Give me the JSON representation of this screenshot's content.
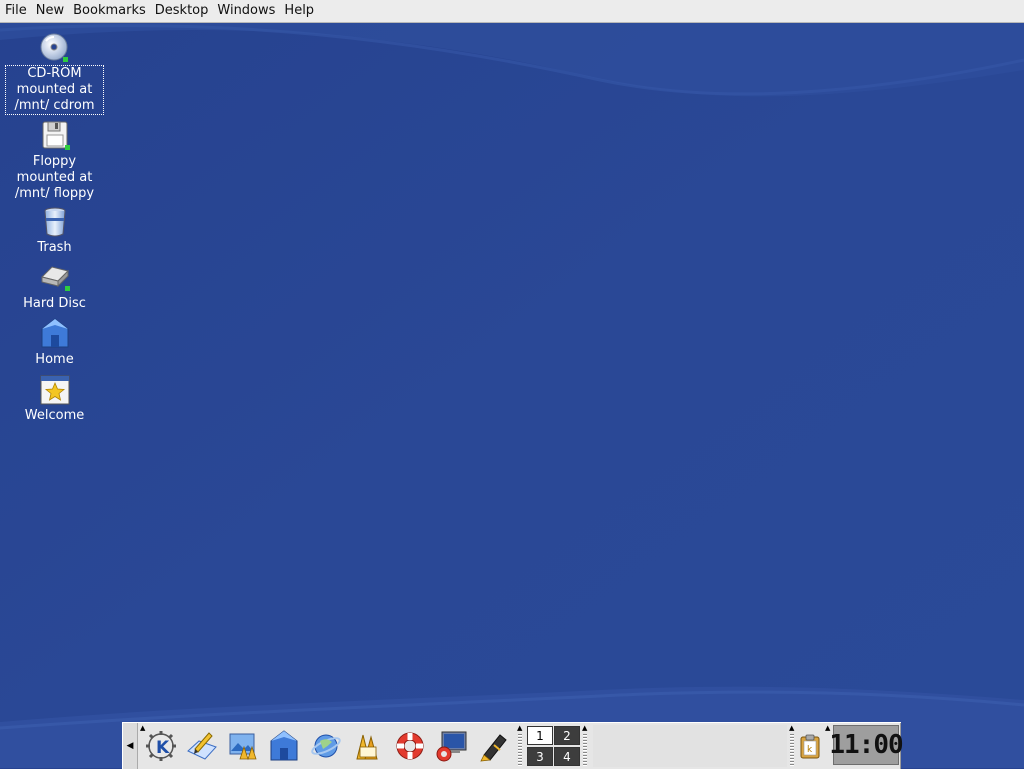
{
  "menubar": {
    "items": [
      "File",
      "New",
      "Bookmarks",
      "Desktop",
      "Windows",
      "Help"
    ]
  },
  "desktop": {
    "icons": [
      {
        "label": "CD-ROM mounted at /mnt/ cdrom",
        "icon": "cdrom-icon"
      },
      {
        "label": "Floppy mounted at /mnt/ floppy",
        "icon": "floppy-icon"
      },
      {
        "label": "Trash",
        "icon": "trash-icon"
      },
      {
        "label": "Hard Disc",
        "icon": "harddisk-icon"
      },
      {
        "label": "Home",
        "icon": "home-icon"
      },
      {
        "label": "Welcome",
        "icon": "welcome-icon"
      }
    ]
  },
  "panel": {
    "launchers": [
      "kde-menu-icon",
      "kmail-icon",
      "desktop-preview-icon",
      "home-folder-icon",
      "konqueror-icon",
      "office-icon",
      "help-lifebuoy-icon",
      "terminal-icon",
      "pen-editor-icon"
    ],
    "pager": {
      "desktops": [
        "1",
        "2",
        "3",
        "4"
      ],
      "active": "1"
    },
    "clock": "11:00"
  },
  "colors": {
    "desktop_bg": "#274391",
    "menubar_bg": "#ececec",
    "panel_bg": "#e6e6e6"
  }
}
